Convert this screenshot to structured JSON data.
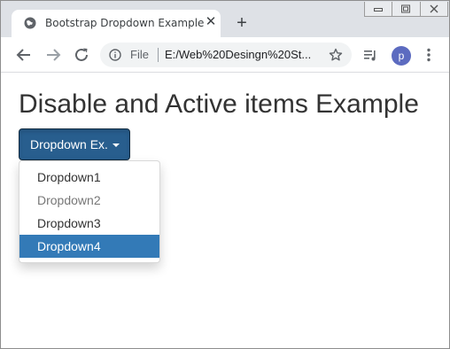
{
  "browser": {
    "tab_title": "Bootstrap Dropdown Example",
    "tab_close": "✕",
    "new_tab": "+",
    "omnibox": {
      "scheme_label": "File",
      "url": "E:/Web%20Desingn%20St..."
    },
    "profile_initial": "p",
    "icons": {
      "favicon": "globe-icon",
      "back": "back-arrow-icon",
      "forward": "forward-arrow-icon",
      "reload": "reload-icon",
      "info": "info-icon",
      "bookmark": "star-icon",
      "media": "media-control-icon",
      "menu": "kebab-menu-icon"
    }
  },
  "page": {
    "heading": "Disable and Active items Example",
    "dropdown": {
      "button_label": "Dropdown Ex.",
      "items": [
        {
          "label": "Dropdown1",
          "state": "normal"
        },
        {
          "label": "Dropdown2",
          "state": "disabled"
        },
        {
          "label": "Dropdown3",
          "state": "normal"
        },
        {
          "label": "Dropdown4",
          "state": "active"
        }
      ]
    }
  },
  "colors": {
    "button_bg": "#285e8e",
    "active_item_bg": "#337ab7",
    "disabled_text": "#777777",
    "avatar_bg": "#5c6bc0"
  }
}
